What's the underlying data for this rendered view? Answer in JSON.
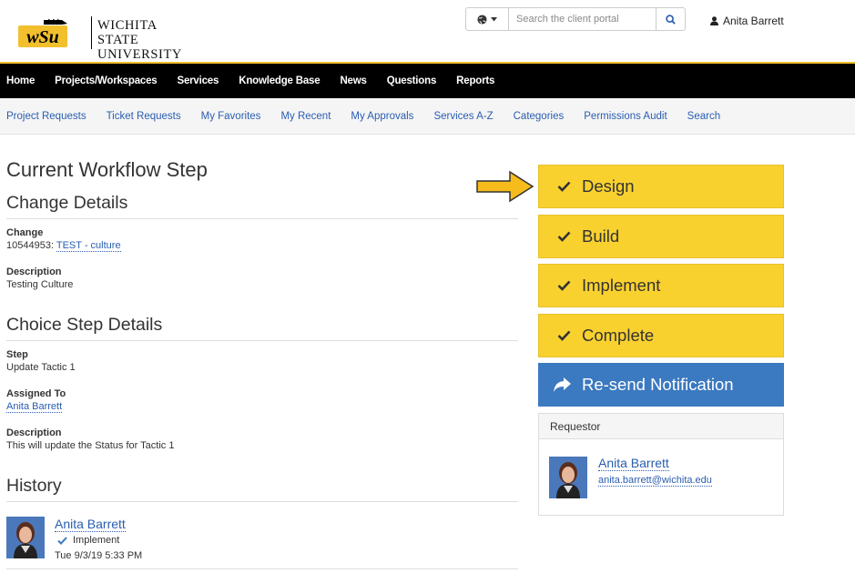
{
  "header": {
    "university_line1": "Wichita State",
    "university_line2": "University",
    "search_placeholder": "Search the client portal",
    "user_name": "Anita Barrett"
  },
  "main_nav": [
    "Home",
    "Projects/Workspaces",
    "Services",
    "Knowledge Base",
    "News",
    "Questions",
    "Reports"
  ],
  "sub_nav": [
    "Project Requests",
    "Ticket Requests",
    "My Favorites",
    "My Recent",
    "My Approvals",
    "Services A-Z",
    "Categories",
    "Permissions Audit",
    "Search"
  ],
  "page_title": "Current Workflow Step",
  "change_details": {
    "heading": "Change Details",
    "change_label": "Change",
    "change_id": "10544953:",
    "change_link": "TEST - culture",
    "description_label": "Description",
    "description_value": "Testing Culture"
  },
  "choice_step": {
    "heading": "Choice Step Details",
    "step_label": "Step",
    "step_value": "Update Tactic 1",
    "assigned_label": "Assigned To",
    "assigned_value": "Anita Barrett",
    "description_label": "Description",
    "description_value": "This will update the Status for Tactic 1"
  },
  "history": {
    "heading": "History",
    "items": [
      {
        "name": "Anita Barrett",
        "status": "Implement",
        "time": "Tue 9/3/19 5:33 PM"
      }
    ]
  },
  "workflow_steps": [
    "Design",
    "Build",
    "Implement",
    "Complete"
  ],
  "resend_label": "Re-send Notification",
  "requestor": {
    "heading": "Requestor",
    "name": "Anita Barrett",
    "email": "anita.barrett@wichita.edu"
  },
  "colors": {
    "gold": "#f9d12f",
    "nav_black": "#000000",
    "link_blue": "#2a5db0",
    "button_blue": "#3b79c0"
  }
}
